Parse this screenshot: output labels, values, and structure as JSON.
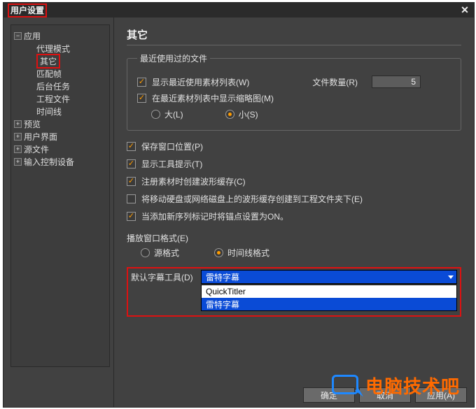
{
  "window": {
    "title": "用户设置",
    "close_glyph": "✕"
  },
  "tree": {
    "apps": {
      "label": "应用",
      "expanded": true
    },
    "apps_children": [
      {
        "label": "代理模式"
      },
      {
        "label": "其它",
        "highlight": true
      },
      {
        "label": "匹配帧"
      },
      {
        "label": "后台任务"
      },
      {
        "label": "工程文件"
      },
      {
        "label": "时间线"
      }
    ],
    "preview": {
      "label": "预览"
    },
    "ui": {
      "label": "用户界面"
    },
    "source": {
      "label": "源文件"
    },
    "input": {
      "label": "输入控制设备"
    }
  },
  "page": {
    "title": "其它",
    "recent": {
      "legend": "最近使用过的文件",
      "show_list": "显示最近使用素材列表(W)",
      "count_label": "文件数量(R)",
      "count_value": "5",
      "show_thumbs": "在最近素材列表中显示缩略图(M)",
      "size_large": "大(L)",
      "size_small": "小(S)"
    },
    "opts": {
      "save_pos": "保存窗口位置(P)",
      "show_tips": "显示工具提示(T)",
      "wave_cache": "注册素材时创建波形缓存(C)",
      "move_cache": "将移动硬盘或网络磁盘上的波形缓存创建到工程文件夹下(E)",
      "anchor_on": "当添加新序列标记时将锚点设置为ON。"
    },
    "play": {
      "label": "播放窗口格式(E)",
      "source": "源格式",
      "timeline": "时间线格式"
    },
    "subtitle": {
      "label": "默认字幕工具(D)",
      "selected": "雷特字幕",
      "options": [
        "QuickTitler",
        "雷特字幕"
      ]
    }
  },
  "footer": {
    "ok": "确定",
    "cancel": "取消",
    "apply": "应用(A)"
  },
  "watermark": "电脑技术吧"
}
